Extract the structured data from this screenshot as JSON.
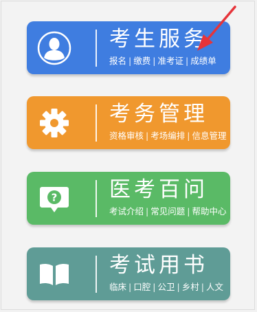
{
  "colors": {
    "service": "#3f7de0",
    "management": "#f0982e",
    "faq": "#5aba66",
    "books": "#5f9c96",
    "arrow": "#e6343a"
  },
  "cards": [
    {
      "title": "考生服务",
      "icon": "user-icon",
      "subs": [
        "报名",
        "缴费",
        "准考证",
        "成绩单"
      ]
    },
    {
      "title": "考务管理",
      "icon": "gear-icon",
      "subs": [
        "资格审核",
        "考场编排",
        "信息管理"
      ]
    },
    {
      "title": "医考百问",
      "icon": "question-chat-icon",
      "subs": [
        "考试介绍",
        "常见问题",
        "帮助中心"
      ]
    },
    {
      "title": "考试用书",
      "icon": "book-icon",
      "subs": [
        "临床",
        "口腔",
        "公卫",
        "乡村",
        "人文"
      ]
    }
  ]
}
